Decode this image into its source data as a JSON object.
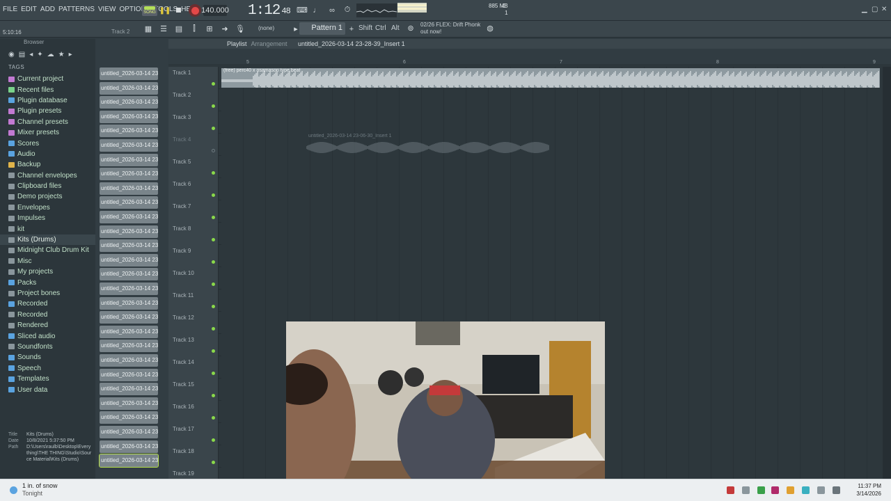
{
  "menu": [
    "FILE",
    "EDIT",
    "ADD",
    "PATTERNS",
    "VIEW",
    "OPTIONS",
    "TOOLS",
    "HELP"
  ],
  "transport": {
    "song_label": "SONG",
    "tempo": "140.000",
    "time_main": "1:12",
    "time_sub": "48",
    "cpu_line1": "0",
    "cpu_line2": "",
    "mem": "885 MB",
    "mem_sub": "1"
  },
  "toolbar2": {
    "position_hint": "5:10:16",
    "track_hint": "Track 2",
    "pattern_select": "(none)",
    "pattern": "Pattern 1",
    "shift": "Shift",
    "ctrl": "Ctrl",
    "alt": "Alt",
    "news_line1": "02/26  FLEX: Drift Phonk",
    "news_line2": "out now!"
  },
  "browser": {
    "header": "Browser",
    "tags_label": "TAGS",
    "items": [
      {
        "label": "Current project",
        "icon": "project-icon",
        "color": "#c27ad2"
      },
      {
        "label": "Recent files",
        "icon": "recent-icon",
        "color": "#7ad28a"
      },
      {
        "label": "Plugin database",
        "icon": "plugin-database-icon",
        "color": "#5aa3e0"
      },
      {
        "label": "Plugin presets",
        "icon": "plugin-presets-icon",
        "color": "#c27ad2"
      },
      {
        "label": "Channel presets",
        "icon": "channel-presets-icon",
        "color": "#c27ad2"
      },
      {
        "label": "Mixer presets",
        "icon": "mixer-presets-icon",
        "color": "#c27ad2"
      },
      {
        "label": "Scores",
        "icon": "scores-icon",
        "color": "#5aa3e0"
      },
      {
        "label": "Audio",
        "icon": "audio-icon",
        "color": "#5aa3e0"
      },
      {
        "label": "Backup",
        "icon": "backup-folder-icon",
        "color": "#e0b44a"
      },
      {
        "label": "Channel envelopes",
        "icon": "folder-icon",
        "color": "#8a969c"
      },
      {
        "label": "Clipboard files",
        "icon": "folder-icon",
        "color": "#8a969c"
      },
      {
        "label": "Demo projects",
        "icon": "folder-icon",
        "color": "#8a969c"
      },
      {
        "label": "Envelopes",
        "icon": "folder-icon",
        "color": "#8a969c"
      },
      {
        "label": "Impulses",
        "icon": "folder-icon",
        "color": "#8a969c"
      },
      {
        "label": "kit",
        "icon": "folder-icon",
        "color": "#8a969c"
      },
      {
        "label": "Kits (Drums)",
        "icon": "folder-icon",
        "color": "#8a969c",
        "selected": true
      },
      {
        "label": "Midnight Club Drum Kit",
        "icon": "folder-icon",
        "color": "#8a969c"
      },
      {
        "label": "Misc",
        "icon": "folder-icon",
        "color": "#8a969c"
      },
      {
        "label": "My projects",
        "icon": "folder-icon",
        "color": "#8a969c"
      },
      {
        "label": "Packs",
        "icon": "packs-icon",
        "color": "#5aa3e0"
      },
      {
        "label": "Project bones",
        "icon": "folder-icon",
        "color": "#8a969c"
      },
      {
        "label": "Recorded",
        "icon": "recorded-icon",
        "color": "#5aa3e0"
      },
      {
        "label": "Recorded",
        "icon": "folder-icon",
        "color": "#8a969c"
      },
      {
        "label": "Rendered",
        "icon": "folder-icon",
        "color": "#8a969c"
      },
      {
        "label": "Sliced audio",
        "icon": "sliced-audio-icon",
        "color": "#5aa3e0"
      },
      {
        "label": "Soundfonts",
        "icon": "folder-icon",
        "color": "#8a969c"
      },
      {
        "label": "Sounds",
        "icon": "sounds-icon",
        "color": "#5aa3e0"
      },
      {
        "label": "Speech",
        "icon": "speech-icon",
        "color": "#5aa3e0"
      },
      {
        "label": "Templates",
        "icon": "templates-icon",
        "color": "#5aa3e0"
      },
      {
        "label": "User data",
        "icon": "user-data-icon",
        "color": "#5aa3e0"
      }
    ],
    "info": {
      "title_key": "Title",
      "title_val": "Kits (Drums)",
      "date_key": "Date",
      "date_val": "10/8/2021 5:37:50 PM",
      "path_key": "Path",
      "path_val": "D:\\Users\\raulb\\Desktop\\Everything\\THE THING\\Studio\\Source Material\\Kits (Drums)"
    }
  },
  "channels": {
    "label": "untitled_2026-03-14 23-...",
    "count": 28
  },
  "playlist": {
    "title": "Playlist",
    "subtitle": "Arrangement",
    "path": "untitled_2026-03-14 23-28-39_Insert 1",
    "ruler": [
      "5",
      "6",
      "7",
      "8",
      "9"
    ],
    "tracks": [
      "Track 1",
      "Track 2",
      "Track 3",
      "Track 4",
      "Track 5",
      "Track 6",
      "Track 7",
      "Track 8",
      "Track 9",
      "Track 10",
      "Track 11",
      "Track 12",
      "Track 13",
      "Track 14",
      "Track 15",
      "Track 16",
      "Track 17",
      "Track 18",
      "Track 19"
    ],
    "clip1_label": "(free) perc40 x osamason type beat",
    "clip2_label": "untitled_2026-03-14 23-06-30_Insert 1"
  },
  "taskbar": {
    "weather": "1 in. of snow",
    "weather_sub": "Tonight",
    "time": "11:37 PM",
    "date": "3/14/2026"
  }
}
